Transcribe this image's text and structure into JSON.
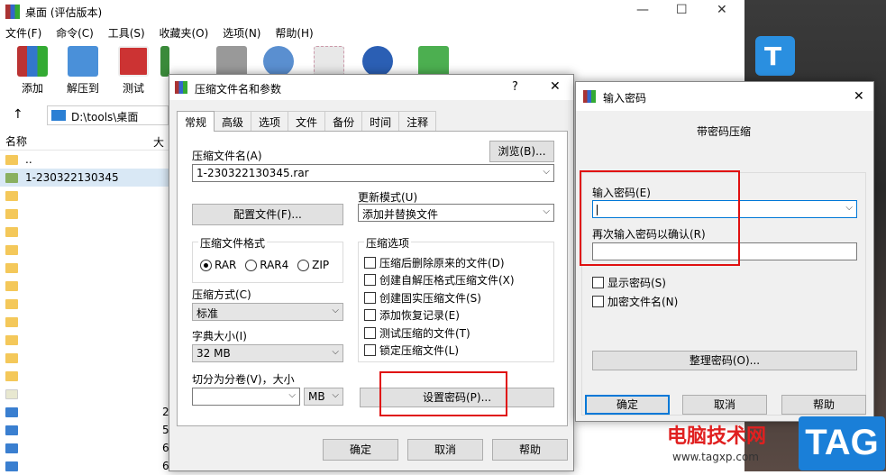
{
  "main": {
    "title": "桌面 (评估版本)",
    "menu": [
      "文件(F)",
      "命令(C)",
      "工具(S)",
      "收藏夹(O)",
      "选项(N)",
      "帮助(H)"
    ],
    "toolbar": [
      "添加",
      "解压到",
      "测试"
    ],
    "address": "D:\\tools\\桌面",
    "col_name": "名称",
    "col_size": "大",
    "files": [
      "..",
      "1-230322130345"
    ],
    "sizes": [
      "2",
      "5",
      "6",
      "6"
    ]
  },
  "dialog1": {
    "title": "压缩文件名和参数",
    "help": "?",
    "tabs": [
      "常规",
      "高级",
      "选项",
      "文件",
      "备份",
      "时间",
      "注释"
    ],
    "archive_name_label": "压缩文件名(A)",
    "browse_label": "浏览(B)...",
    "archive_name_value": "1-230322130345.rar",
    "update_mode_label": "更新模式(U)",
    "update_mode_value": "添加并替换文件",
    "profiles_label": "配置文件(F)...",
    "format_label": "压缩文件格式",
    "formats": [
      "RAR",
      "RAR4",
      "ZIP"
    ],
    "options_label": "压缩选项",
    "options": [
      "压缩后删除原来的文件(D)",
      "创建自解压格式压缩文件(X)",
      "创建固实压缩文件(S)",
      "添加恢复记录(E)",
      "测试压缩的文件(T)",
      "锁定压缩文件(L)"
    ],
    "method_label": "压缩方式(C)",
    "method_value": "标准",
    "dict_label": "字典大小(I)",
    "dict_value": "32 MB",
    "split_label": "切分为分卷(V)，大小",
    "split_unit": "MB",
    "set_password": "设置密码(P)...",
    "ok": "确定",
    "cancel": "取消",
    "help_btn": "帮助"
  },
  "dialog2": {
    "title": "输入密码",
    "heading": "带密码压缩",
    "enter_label": "输入密码(E)",
    "confirm_label": "再次输入密码以确认(R)",
    "show_password": "显示密码(S)",
    "encrypt_names": "加密文件名(N)",
    "organize": "整理密码(O)...",
    "ok": "确定",
    "cancel": "取消",
    "help": "帮助"
  },
  "watermark": {
    "cn": "电脑技术网",
    "url": "www.tagxp.com",
    "tag": "TAG"
  },
  "colors": {
    "accent": "#0078d7",
    "highlight": "#e01010"
  }
}
